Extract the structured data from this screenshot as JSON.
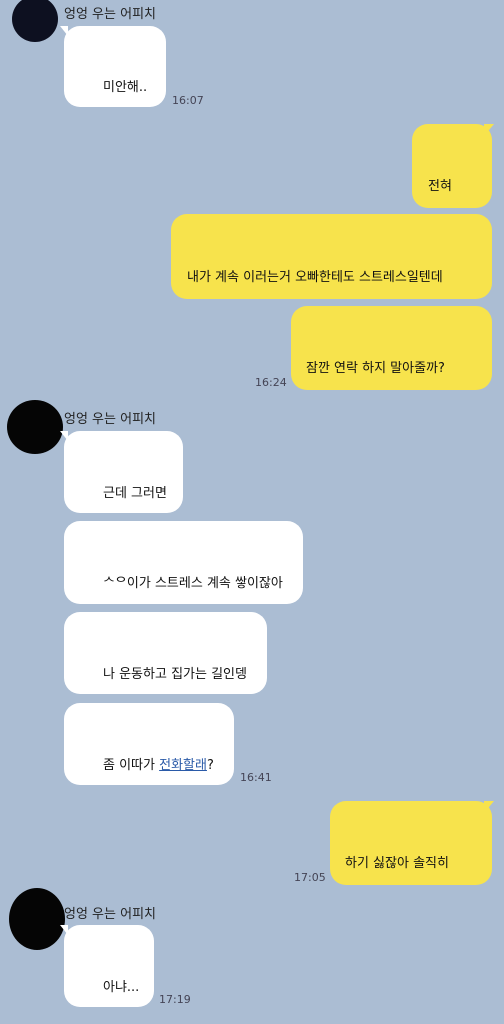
{
  "groups": [
    {
      "sender": "엉엉 우는 어피치",
      "messages": [
        {
          "text": "미안해..",
          "time": "16:07"
        }
      ]
    },
    {
      "sender": "me",
      "messages": [
        {
          "text": "전혀"
        },
        {
          "text": "내가 계속 이러는거 오빠한테도 스트레스일텐데"
        },
        {
          "text": "잠깐 연락 하지 말아줄까?",
          "time": "16:24"
        }
      ]
    },
    {
      "sender": "엉엉 우는 어피치",
      "messages": [
        {
          "text": "근데 그러면"
        },
        {
          "text": "ᄉᄋ이가 스트레스 계속 쌓이잖아"
        },
        {
          "text": "나 운동하고 집가는 길인뎅"
        },
        {
          "text_before": "좀 이따가 ",
          "link_text": "전화할래",
          "text_after": "?",
          "time": "16:41"
        }
      ]
    },
    {
      "sender": "me",
      "messages": [
        {
          "text": "하기 싫잖아 솔직히",
          "time": "17:05"
        }
      ]
    },
    {
      "sender": "엉엉 우는 어피치",
      "messages": [
        {
          "text": "아냐...",
          "time": "17:19"
        }
      ]
    }
  ],
  "colors": {
    "background": "#abbdd3",
    "incoming_bubble": "#ffffff",
    "outgoing_bubble": "#f7e34c",
    "link": "#2a5aa8"
  }
}
